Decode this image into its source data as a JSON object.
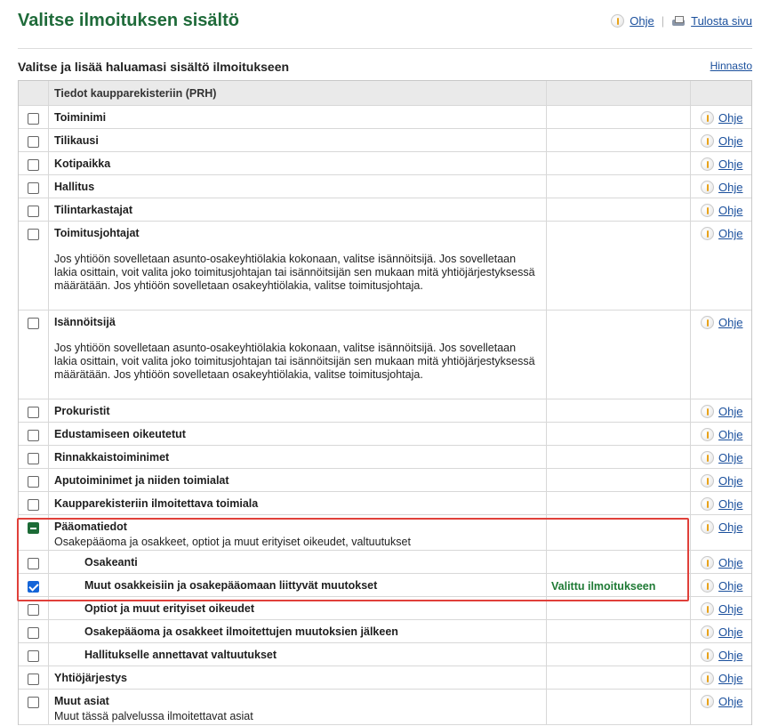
{
  "header": {
    "title": "Valitse ilmoituksen sisältö",
    "help_label": "Ohje",
    "print_label": "Tulosta sivu"
  },
  "subheader": {
    "title": "Valitse ja lisää haluamasi sisältö ilmoitukseen",
    "pricing_label": "Hinnasto"
  },
  "table": {
    "header": "Tiedot kaupparekisteriin (PRH)",
    "help_label": "Ohje",
    "rows": [
      {
        "label": "Toiminimi",
        "state": "unchecked"
      },
      {
        "label": "Tilikausi",
        "state": "unchecked"
      },
      {
        "label": "Kotipaikka",
        "state": "unchecked"
      },
      {
        "label": "Hallitus",
        "state": "unchecked"
      },
      {
        "label": "Tilintarkastajat",
        "state": "unchecked"
      },
      {
        "label": "Toimitusjohtajat",
        "state": "unchecked",
        "description": "Jos yhtiöön sovelletaan asunto-osakeyhtiölakia kokonaan, valitse isännöitsijä. Jos sovelletaan lakia osittain, voit valita joko toimitusjohtajan tai isännöitsijän sen mukaan mitä yhtiöjärjestyksessä määrätään. Jos yhtiöön sovelletaan osakeyhtiölakia, valitse toimitusjohtaja."
      },
      {
        "label": "Isännöitsijä",
        "state": "unchecked",
        "description": "Jos yhtiöön sovelletaan asunto-osakeyhtiölakia kokonaan, valitse isännöitsijä. Jos sovelletaan lakia osittain, voit valita joko toimitusjohtajan tai isännöitsijän sen mukaan mitä yhtiöjärjestyksessä määrätään. Jos yhtiöön sovelletaan osakeyhtiölakia, valitse toimitusjohtaja."
      },
      {
        "label": "Prokuristit",
        "state": "unchecked"
      },
      {
        "label": "Edustamiseen oikeutetut",
        "state": "unchecked"
      },
      {
        "label": "Rinnakkaistoiminimet",
        "state": "unchecked"
      },
      {
        "label": "Aputoiminimet ja niiden toimialat",
        "state": "unchecked"
      },
      {
        "label": "Kaupparekisteriin ilmoitettava toimiala",
        "state": "unchecked"
      },
      {
        "label": "Pääomatiedot",
        "state": "partial",
        "description": "Osakepääoma ja osakkeet, optiot ja muut erityiset oikeudet, valtuutukset"
      },
      {
        "label": "Osakeanti",
        "state": "unchecked",
        "indent": true
      },
      {
        "label": "Muut osakkeisiin ja osakepääomaan liittyvät muutokset",
        "state": "checked",
        "indent": true,
        "status": "Valittu ilmoitukseen"
      },
      {
        "label": "Optiot ja muut erityiset oikeudet",
        "state": "unchecked",
        "indent": true
      },
      {
        "label": "Osakepääoma ja osakkeet ilmoitettujen muutoksien jälkeen",
        "state": "unchecked",
        "indent": true
      },
      {
        "label": "Hallitukselle annettavat valtuutukset",
        "state": "unchecked",
        "indent": true
      },
      {
        "label": "Yhtiöjärjestys",
        "state": "unchecked"
      },
      {
        "label": "Muut asiat",
        "state": "unchecked",
        "description": "Muut tässä palvelussa ilmoitettavat asiat"
      }
    ]
  },
  "colors": {
    "title_green": "#1f6b3a",
    "status_green": "#1f7a35",
    "link_blue": "#1a4f9c",
    "highlight_red": "#e0403a",
    "checkbox_blue": "#1565d8"
  },
  "icons": {
    "help": "info-icon",
    "print": "printer-icon"
  }
}
